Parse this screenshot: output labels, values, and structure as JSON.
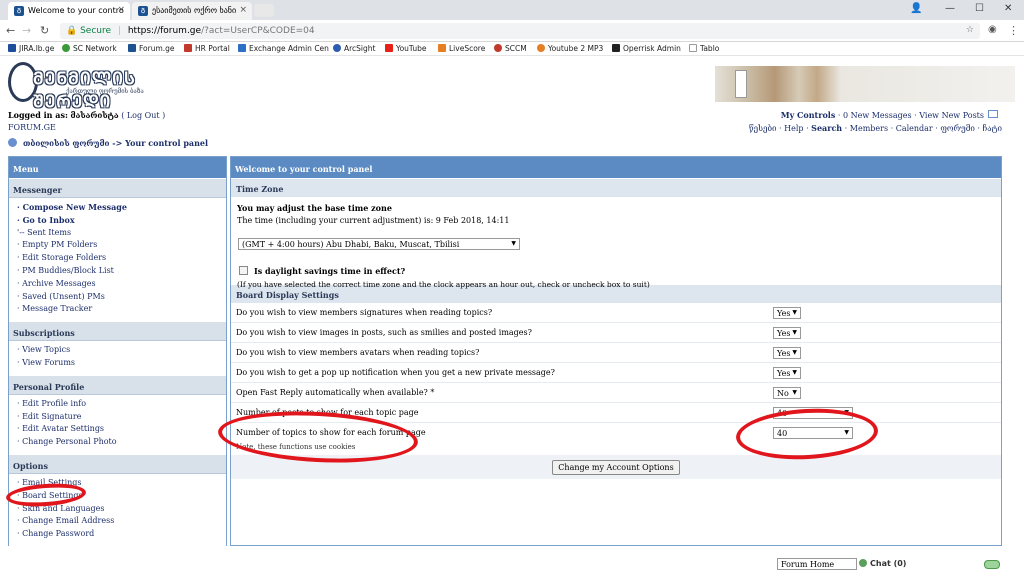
{
  "browser": {
    "tabs": [
      {
        "title": "Welcome to your contro",
        "active": true
      },
      {
        "title": "ესაიმეთის ოქრო ხანი",
        "active": false
      }
    ],
    "url": {
      "secure_label": "Secure",
      "host": "https://forum.ge",
      "rest": "/?act=UserCP&CODE=04"
    },
    "bookmarks": [
      {
        "label": "JIRA.lb.ge",
        "color": "#1d4e9e"
      },
      {
        "label": "SC Network",
        "color": "#3a9a3a"
      },
      {
        "label": "Forum.ge",
        "color": "#1d5290"
      },
      {
        "label": "HR Portal",
        "color": "#c0392b"
      },
      {
        "label": "Exchange Admin Cen",
        "color": "#2d6fc4"
      },
      {
        "label": "ArcSight",
        "color": "#2d5db0"
      },
      {
        "label": "YouTube",
        "color": "#e62117"
      },
      {
        "label": "LiveScore",
        "color": "#e67e22"
      },
      {
        "label": "SCCM",
        "color": "#c0392b"
      },
      {
        "label": "Youtube 2 MP3",
        "color": "#e67e22"
      },
      {
        "label": "Operrisk Admin",
        "color": "#222222"
      },
      {
        "label": "Tablo",
        "color": "#999999"
      }
    ]
  },
  "header": {
    "logo_title": "ᲛᲔᲜᲛᲘᲚᲘᲡ ᲨᲔᲠᲔᲓᲘ",
    "logo_subtitle": "ქართული ფორუმის ბაზა",
    "logged_in_label": "Logged in as:",
    "username": "მასარისტა",
    "logout_label": "( Log Out )",
    "site_name": "FORUM.GE",
    "breadcrumb_link": "თბილისის ფორუმი",
    "breadcrumb_current": "-> Your control panel",
    "my_controls": "My Controls",
    "new_messages": "0 New Messages",
    "view_new_posts": "View New Posts",
    "links": [
      "წესები",
      "Help",
      "Search",
      "Members",
      "Calendar",
      "ფორუმი",
      "ჩატი"
    ]
  },
  "menu": {
    "title": "Menu",
    "sections": [
      {
        "title": "Messenger",
        "items": [
          {
            "label": "· Compose New Message",
            "bold": true
          },
          {
            "label": "· Go to Inbox",
            "bold": true
          },
          {
            "label": "'-- Sent Items",
            "bold": false
          },
          {
            "label": "· Empty PM Folders",
            "bold": false
          },
          {
            "label": "· Edit Storage Folders",
            "bold": false
          },
          {
            "label": "· PM Buddies/Block List",
            "bold": false
          },
          {
            "label": "· Archive Messages",
            "bold": false
          },
          {
            "label": "· Saved (Unsent) PMs",
            "bold": false
          },
          {
            "label": "· Message Tracker",
            "bold": false
          }
        ]
      },
      {
        "title": "Subscriptions",
        "items": [
          {
            "label": "· View Topics",
            "bold": false
          },
          {
            "label": "· View Forums",
            "bold": false
          }
        ]
      },
      {
        "title": "Personal Profile",
        "items": [
          {
            "label": "· Edit Profile info",
            "bold": false
          },
          {
            "label": "· Edit Signature",
            "bold": false
          },
          {
            "label": "· Edit Avatar Settings",
            "bold": false
          },
          {
            "label": "· Change Personal Photo",
            "bold": false
          }
        ]
      },
      {
        "title": "Options",
        "items": [
          {
            "label": "· Email Settings",
            "bold": false
          },
          {
            "label": "· Board Settings",
            "bold": false
          },
          {
            "label": "· Skin and Languages",
            "bold": false
          },
          {
            "label": "· Change Email Address",
            "bold": false
          },
          {
            "label": "· Change Password",
            "bold": false
          }
        ]
      }
    ]
  },
  "panel": {
    "title": "Welcome to your control panel",
    "timezone_section": "Time Zone",
    "tz_title": "You may adjust the base time zone",
    "tz_time": "The time (including your current adjustment) is: 9 Feb 2018, 14:11",
    "tz_selected": "(GMT + 4:00 hours) Abu Dhabi, Baku, Muscat, Tbilisi",
    "dst_label": "Is daylight savings time in effect?",
    "dst_note": "(If you have selected the correct time zone and the clock appears an hour out, check or uncheck box to suit)",
    "board_section": "Board Display Settings",
    "options": [
      {
        "label": "Do you wish to view members signatures when reading topics?",
        "value": "Yes",
        "kind": "yes"
      },
      {
        "label": "Do you wish to view images in posts, such as smilies and posted images?",
        "value": "Yes",
        "kind": "yes"
      },
      {
        "label": "Do you wish to view members avatars when reading topics?",
        "value": "Yes",
        "kind": "yes"
      },
      {
        "label": "Do you wish to get a pop up notification when you get a new private message?",
        "value": "Yes",
        "kind": "yes"
      },
      {
        "label": "Open Fast Reply automatically when available? *",
        "value": "No",
        "kind": "yes"
      },
      {
        "label": "Number of posts to show for each topic page",
        "value": "40",
        "kind": "num"
      },
      {
        "label": "Number of topics to show for each forum page",
        "value": "40",
        "kind": "num"
      }
    ],
    "note": "Note, these functions use cookies",
    "submit_label": "Change my Account Options"
  },
  "footer": {
    "forum_home": "Forum Home",
    "chat_label": "Chat (0)"
  },
  "colors": {
    "header_blue": "#5b8bc2",
    "link_navy": "#1d2f6b",
    "annotation_red": "#e0161c"
  }
}
